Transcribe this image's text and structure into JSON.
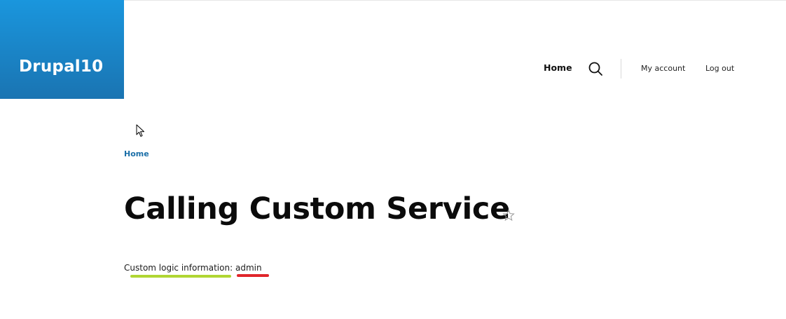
{
  "site": {
    "name": "Drupal10",
    "brand_gradient": [
      "#1a96dd",
      "#1a74b2"
    ]
  },
  "nav": {
    "home_label": "Home",
    "search_icon": "search-icon",
    "my_account_label": "My account",
    "logout_label": "Log out"
  },
  "breadcrumb": {
    "home_label": "Home"
  },
  "page": {
    "title": "Calling Custom Service",
    "favorite_icon": "star-icon"
  },
  "content": {
    "label": "Custom logic information:",
    "value": "admin"
  },
  "annotations": {
    "label_underline_color": "#b0d633",
    "value_underline_color": "#e0262b"
  }
}
